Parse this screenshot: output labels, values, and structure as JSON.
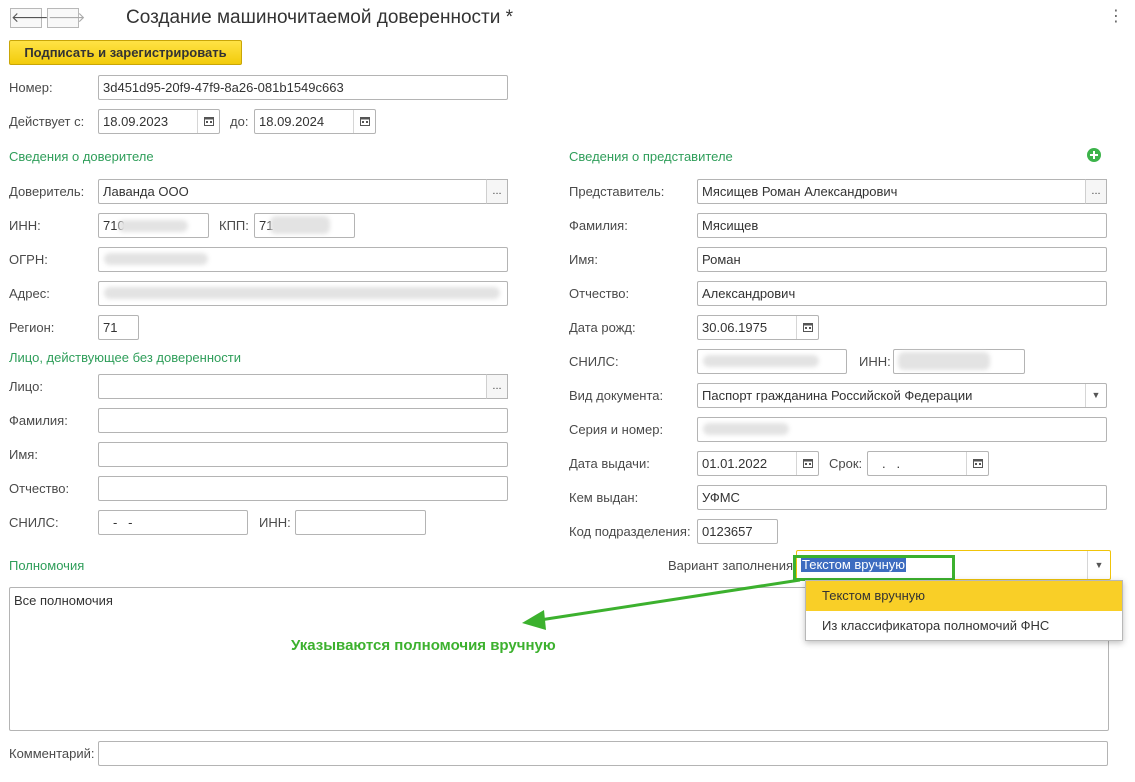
{
  "header": {
    "title": "Создание машиночитаемой доверенности *",
    "back_glyph": "🡐",
    "forward_glyph": "🡒",
    "menu_glyph": "⋮"
  },
  "toolbar": {
    "sign_label": "Подписать и зарегистрировать"
  },
  "top": {
    "number_label": "Номер:",
    "number_value": "3d451d95-20f9-47f9-8a26-081b1549c663",
    "valid_from_label": "Действует с:",
    "valid_from_value": "18.09.2023",
    "valid_to_label": "до:",
    "valid_to_value": "18.09.2024"
  },
  "principal": {
    "section_title": "Сведения о доверителе",
    "principal_label": "Доверитель:",
    "principal_value": "Лаванда ООО",
    "inn_label": "ИНН:",
    "inn_value": "710",
    "kpp_label": "КПП:",
    "kpp_value": "71",
    "ogrn_label": "ОГРН:",
    "address_label": "Адрес:",
    "region_label": "Регион:",
    "region_value": "71"
  },
  "person": {
    "section_title": "Лицо, действующее без доверенности",
    "person_label": "Лицо:",
    "lastname_label": "Фамилия:",
    "firstname_label": "Имя:",
    "patronymic_label": "Отчество:",
    "snils_label": "СНИЛС:",
    "snils_value": "-   -",
    "inn_label": "ИНН:"
  },
  "representative": {
    "section_title": "Сведения о представителе",
    "rep_label": "Представитель:",
    "rep_value": "Мясищев Роман Александрович",
    "lastname_label": "Фамилия:",
    "lastname_value": "Мясищев",
    "firstname_label": "Имя:",
    "firstname_value": "Роман",
    "patronymic_label": "Отчество:",
    "patronymic_value": "Александрович",
    "birth_label": "Дата рожд:",
    "birth_value": "30.06.1975",
    "snils_label": "СНИЛС:",
    "inn_label": "ИНН:",
    "doc_type_label": "Вид документа:",
    "doc_type_value": "Паспорт гражданина Российской Федерации",
    "series_label": "Серия и номер:",
    "issue_date_label": "Дата выдачи:",
    "issue_date_value": "01.01.2022",
    "term_label": "Срок:",
    "term_value": ".   .",
    "issued_by_label": "Кем выдан:",
    "issued_by_value": "УФМС",
    "dept_code_label": "Код подразделения:",
    "dept_code_value": "0123657"
  },
  "powers": {
    "section_title": "Полномочия",
    "fill_variant_label": "Вариант заполнения:",
    "fill_variant_value": "Текстом вручную",
    "text_value": "Все полномочия",
    "dropdown_options": [
      "Текстом вручную",
      "Из классификатора полномочий ФНС"
    ],
    "annotation": "Указываются полномочия вручную"
  },
  "comment": {
    "label": "Комментарий:"
  },
  "colors": {
    "accent_green": "#2f9e5a",
    "annotation_green": "#3cb12e",
    "button_yellow": "#f7d117",
    "selection_blue": "#3d6cc0"
  }
}
